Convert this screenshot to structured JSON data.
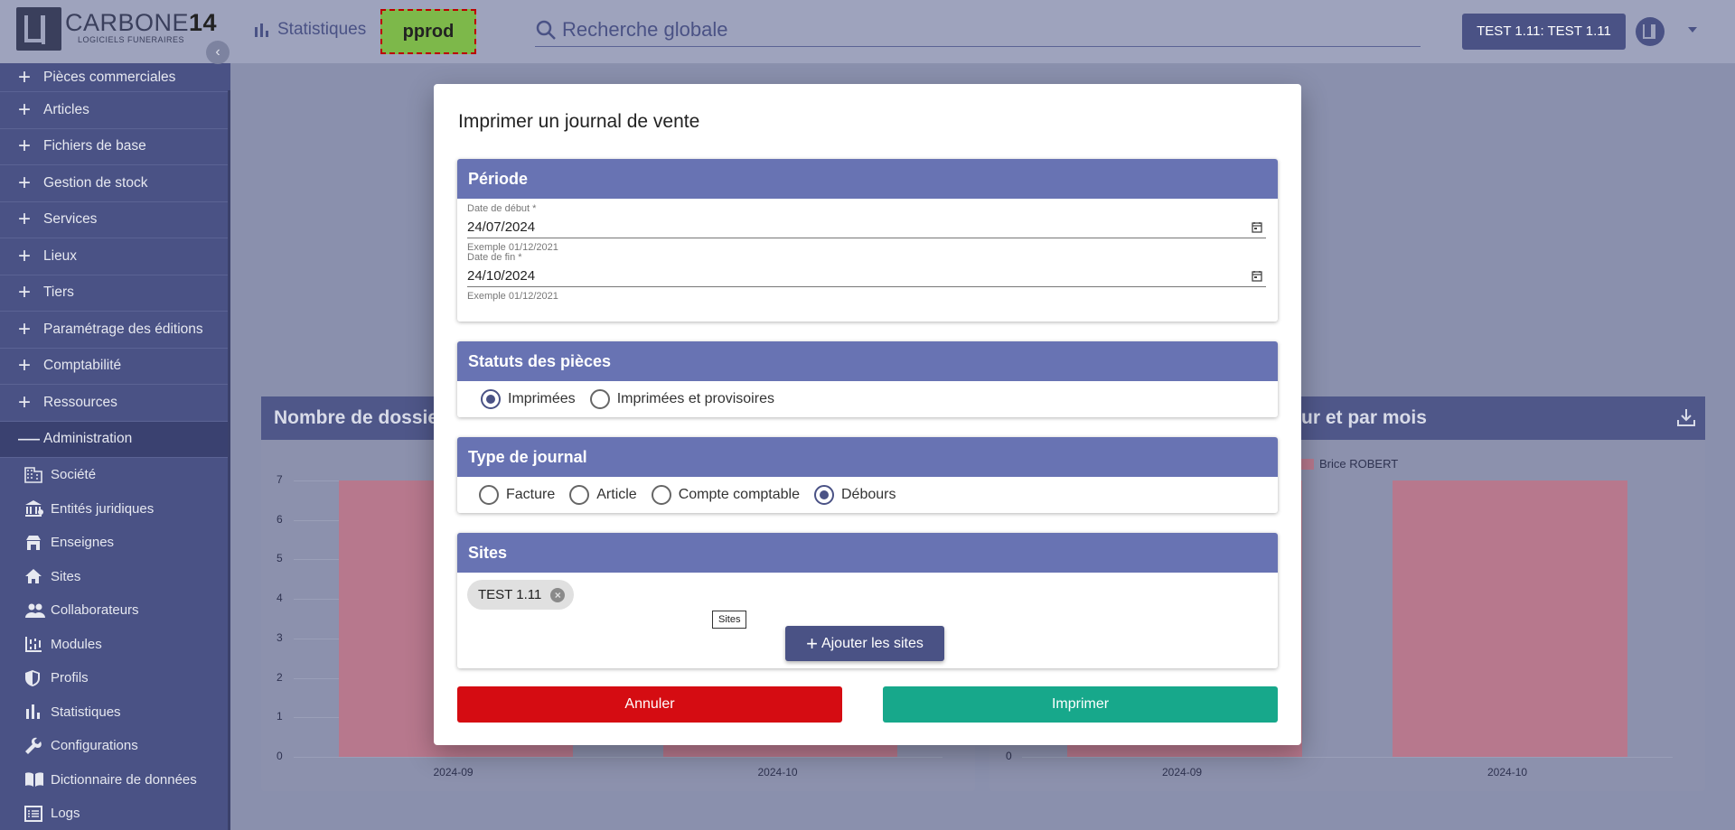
{
  "logo": {
    "brand_main": "CARBONE",
    "brand_num": "14",
    "tagline": "LOGICIELS FUNERAIRES"
  },
  "header": {
    "stats_label": "Statistiques",
    "env_badge": "pprod",
    "search_placeholder": "Recherche globale",
    "user_label": "TEST 1.11: TEST 1.11"
  },
  "sidebar": {
    "items": [
      {
        "label": "Pièces commerciales"
      },
      {
        "label": "Articles"
      },
      {
        "label": "Fichiers de base"
      },
      {
        "label": "Gestion de stock"
      },
      {
        "label": "Services"
      },
      {
        "label": "Lieux"
      },
      {
        "label": "Tiers"
      },
      {
        "label": "Paramétrage des éditions"
      },
      {
        "label": "Comptabilité"
      },
      {
        "label": "Ressources"
      }
    ],
    "admin_label": "Administration",
    "sub_items": [
      {
        "label": "Société",
        "icon": "building-icon"
      },
      {
        "label": "Entités juridiques",
        "icon": "bank-icon"
      },
      {
        "label": "Enseignes",
        "icon": "storefront-icon"
      },
      {
        "label": "Sites",
        "icon": "home-icon"
      },
      {
        "label": "Collaborateurs",
        "icon": "people-icon"
      },
      {
        "label": "Modules",
        "icon": "modules-icon"
      },
      {
        "label": "Profils",
        "icon": "shield-icon"
      },
      {
        "label": "Statistiques",
        "icon": "bar-chart-icon"
      },
      {
        "label": "Configurations",
        "icon": "wrench-icon"
      },
      {
        "label": "Dictionnaire de données",
        "icon": "book-icon"
      },
      {
        "label": "Logs",
        "icon": "list-icon"
      }
    ]
  },
  "dashboard": {
    "left_card_title": "Nombre de dossiers",
    "right_card_title": "ur et par mois",
    "legend": "Brice ROBERT"
  },
  "chart_data": [
    {
      "type": "bar",
      "title": "Nombre de dossiers",
      "categories": [
        "2024-09",
        "2024-10"
      ],
      "series": [
        {
          "values": [
            7,
            7
          ]
        }
      ],
      "yticks": [
        "0",
        "1",
        "2",
        "3",
        "4",
        "5",
        "6",
        "7"
      ],
      "ylim": [
        0,
        7
      ]
    },
    {
      "type": "bar",
      "title": "ur et par mois",
      "categories": [
        "2024-09",
        "2024-10"
      ],
      "series": [
        {
          "name": "Brice ROBERT",
          "values": [
            7,
            7
          ]
        }
      ],
      "yticks": [
        "0"
      ],
      "ylim": [
        0,
        7
      ],
      "legend": "top"
    }
  ],
  "modal": {
    "title": "Imprimer un journal de vente",
    "periode": {
      "heading": "Période",
      "start_label": "Date de début *",
      "start_value": "24/07/2024",
      "start_hint": "Exemple 01/12/2021",
      "end_label": "Date de fin *",
      "end_value": "24/10/2024",
      "end_hint": "Exemple 01/12/2021"
    },
    "statuts": {
      "heading": "Statuts des pièces",
      "options": [
        "Imprimées",
        "Imprimées et provisoires"
      ],
      "selected": "Imprimées"
    },
    "type_journal": {
      "heading": "Type de journal",
      "options": [
        "Facture",
        "Article",
        "Compte comptable",
        "Débours"
      ],
      "selected": "Débours"
    },
    "sites": {
      "heading": "Sites",
      "chip": "TEST 1.11",
      "tooltip": "Sites",
      "add_button": "Ajouter les sites"
    },
    "cancel_label": "Annuler",
    "print_label": "Imprimer"
  },
  "colors": {
    "primary": "#4a5285",
    "panel_header": "#6873b3",
    "cancel": "#d50c12",
    "print": "#17a88b",
    "env_badge": "#7db84a"
  }
}
